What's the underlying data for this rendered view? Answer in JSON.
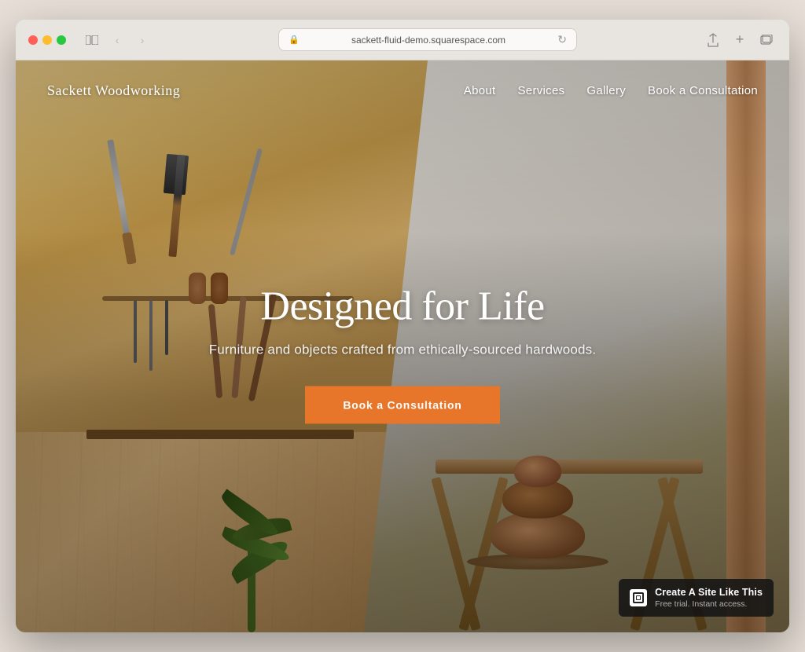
{
  "browser": {
    "url": "sackett-fluid-demo.squarespace.com",
    "traffic_lights": [
      "close",
      "minimize",
      "maximize"
    ],
    "nav_back": "‹",
    "nav_forward": "›",
    "reload": "↻",
    "share_icon": "⬆",
    "new_tab_icon": "+",
    "windows_icon": "⧉"
  },
  "site": {
    "logo": "Sackett Woodworking",
    "nav": {
      "items": [
        "About",
        "Services",
        "Gallery",
        "Book a Consultation"
      ]
    },
    "hero": {
      "title": "Designed for Life",
      "subtitle": "Furniture and objects crafted from ethically-sourced hardwoods.",
      "cta_label": "Book a Consultation"
    },
    "badge": {
      "main_text": "Create A Site Like This",
      "sub_text": "Free trial. Instant access."
    }
  },
  "colors": {
    "cta_orange": "#e8762a",
    "nav_text": "#ffffff",
    "hero_title": "#ffffff",
    "hero_subtitle": "rgba(255,255,255,0.92)",
    "badge_bg": "rgba(20,20,20,0.88)"
  }
}
